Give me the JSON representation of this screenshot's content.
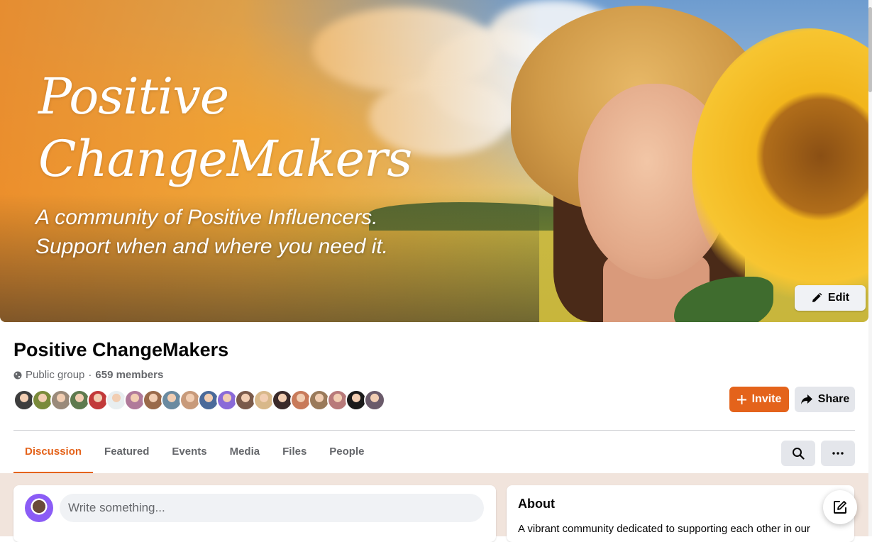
{
  "cover": {
    "title_line1": "Positive",
    "title_line2": "ChangeMakers",
    "tagline_line1": "A community of Positive Influencers.",
    "tagline_line2": "Support when and where you need it.",
    "edit_label": "Edit"
  },
  "group": {
    "name": "Positive ChangeMakers",
    "privacy": "Public group",
    "separator": "·",
    "member_count": "659 members",
    "member_avatar_colors": [
      "#3d3d3d",
      "#7a8a3a",
      "#9a8a7a",
      "#5e7a4e",
      "#c23a3a",
      "#e8eef0",
      "#b07a9a",
      "#9a6a4a",
      "#6a8aa0",
      "#c89a7a",
      "#4a6a9a",
      "#8a6ad8",
      "#7a5a4a",
      "#d8b88a",
      "#3a2a2a",
      "#c87a5a",
      "#9a7a5a",
      "#b87a7a",
      "#1a1a1a",
      "#6a5a6a"
    ]
  },
  "actions": {
    "invite_label": "Invite",
    "share_label": "Share"
  },
  "tabs": [
    {
      "label": "Discussion"
    },
    {
      "label": "Featured"
    },
    {
      "label": "Events"
    },
    {
      "label": "Media"
    },
    {
      "label": "Files"
    },
    {
      "label": "People"
    }
  ],
  "composer": {
    "placeholder": "Write something..."
  },
  "about": {
    "title": "About",
    "text": "A vibrant community dedicated to supporting each other in our"
  },
  "colors": {
    "accent": "#e4631b",
    "secondary_button": "#e4e6eb",
    "feed_background": "#f1e4dc"
  },
  "icons": {
    "privacy": "globe-icon",
    "invite": "plus-icon",
    "share": "share-arrow-icon",
    "edit": "pencil-icon",
    "search": "search-icon",
    "more": "more-dots-icon",
    "new_post": "compose-icon"
  }
}
